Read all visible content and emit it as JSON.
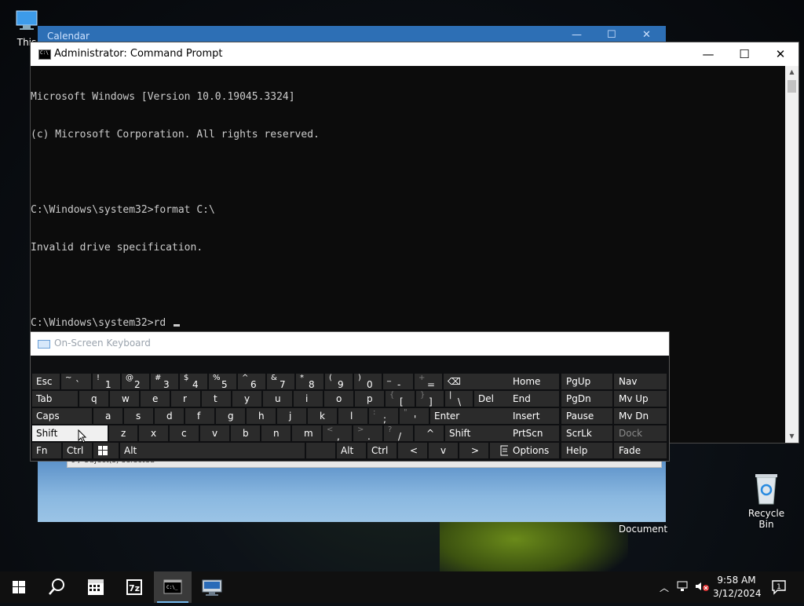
{
  "desktop": {
    "this_pc_label": "This",
    "recycle_bin_label": "Recycle Bin",
    "document_label": "Document"
  },
  "calendar_window": {
    "title": "Calendar"
  },
  "document_window": {
    "status": "0 / Object(s) selected"
  },
  "cmd": {
    "title": "Administrator: Command Prompt",
    "lines": [
      "Microsoft Windows [Version 10.0.19045.3324]",
      "(c) Microsoft Corporation. All rights reserved.",
      "",
      "C:\\Windows\\system32>format C:\\",
      "Invalid drive specification.",
      "",
      "C:\\Windows\\system32>rd "
    ],
    "controls": {
      "minimize": "—",
      "maximize": "☐",
      "close": "✕"
    }
  },
  "osk": {
    "title": "On-Screen Keyboard",
    "rows": [
      [
        {
          "m": "Esc"
        },
        {
          "s": "~",
          "m": "`"
        },
        {
          "s": "!",
          "m": "1"
        },
        {
          "s": "@",
          "m": "2"
        },
        {
          "s": "#",
          "m": "3"
        },
        {
          "s": "$",
          "m": "4"
        },
        {
          "s": "%",
          "m": "5"
        },
        {
          "s": "^",
          "m": "6"
        },
        {
          "s": "&",
          "m": "7"
        },
        {
          "s": "*",
          "m": "8"
        },
        {
          "s": "(",
          "m": "9"
        },
        {
          "s": ")",
          "m": "0"
        },
        {
          "s": "_",
          "m": "-"
        },
        {
          "s": "+",
          "m": "="
        },
        {
          "m": "⌫"
        }
      ],
      [
        {
          "m": "Tab"
        },
        {
          "m": "q"
        },
        {
          "m": "w"
        },
        {
          "m": "e"
        },
        {
          "m": "r"
        },
        {
          "m": "t"
        },
        {
          "m": "y"
        },
        {
          "m": "u"
        },
        {
          "m": "i"
        },
        {
          "m": "o"
        },
        {
          "m": "p"
        },
        {
          "s": "{",
          "m": "["
        },
        {
          "s": "}",
          "m": "]"
        },
        {
          "s": "|",
          "m": "\\"
        },
        {
          "m": "Del"
        }
      ],
      [
        {
          "m": "Caps"
        },
        {
          "m": "a"
        },
        {
          "m": "s"
        },
        {
          "m": "d"
        },
        {
          "m": "f"
        },
        {
          "m": "g"
        },
        {
          "m": "h"
        },
        {
          "m": "j"
        },
        {
          "m": "k"
        },
        {
          "m": "l"
        },
        {
          "s": ":",
          "m": ";"
        },
        {
          "s": "\"",
          "m": "'"
        },
        {
          "m": "Enter"
        }
      ],
      [
        {
          "m": "Shift"
        },
        {
          "m": "z"
        },
        {
          "m": "x"
        },
        {
          "m": "c"
        },
        {
          "m": "v"
        },
        {
          "m": "b"
        },
        {
          "m": "n"
        },
        {
          "m": "m"
        },
        {
          "s": "<",
          "m": ","
        },
        {
          "s": ">",
          "m": "."
        },
        {
          "s": "?",
          "m": "/"
        },
        {
          "m": "^"
        },
        {
          "m": "Shift"
        }
      ],
      [
        {
          "m": "Fn"
        },
        {
          "m": "Ctrl"
        },
        {
          "m": "win"
        },
        {
          "m": "Alt"
        },
        {
          "m": ""
        },
        {
          "m": "Alt"
        },
        {
          "m": "Ctrl"
        },
        {
          "m": "<"
        },
        {
          "m": "v"
        },
        {
          "m": ">"
        },
        {
          "m": "menu"
        }
      ]
    ],
    "nav_keys": [
      [
        "Home",
        "PgUp",
        "Nav"
      ],
      [
        "End",
        "PgDn",
        "Mv Up"
      ],
      [
        "Insert",
        "Pause",
        "Mv Dn"
      ],
      [
        "PrtScn",
        "ScrLk",
        "Dock"
      ],
      [
        "Options",
        "Help",
        "Fade"
      ]
    ]
  },
  "taskbar": {
    "time": "9:58 AM",
    "date": "3/12/2024",
    "notification_count": "1",
    "apps": [
      "start",
      "search",
      "calendar",
      "7zip",
      "command-prompt",
      "network-app"
    ]
  },
  "colors": {
    "accent": "#2d6fb5",
    "osk_key": "#2b2b2b",
    "console_text": "#cccccc"
  }
}
